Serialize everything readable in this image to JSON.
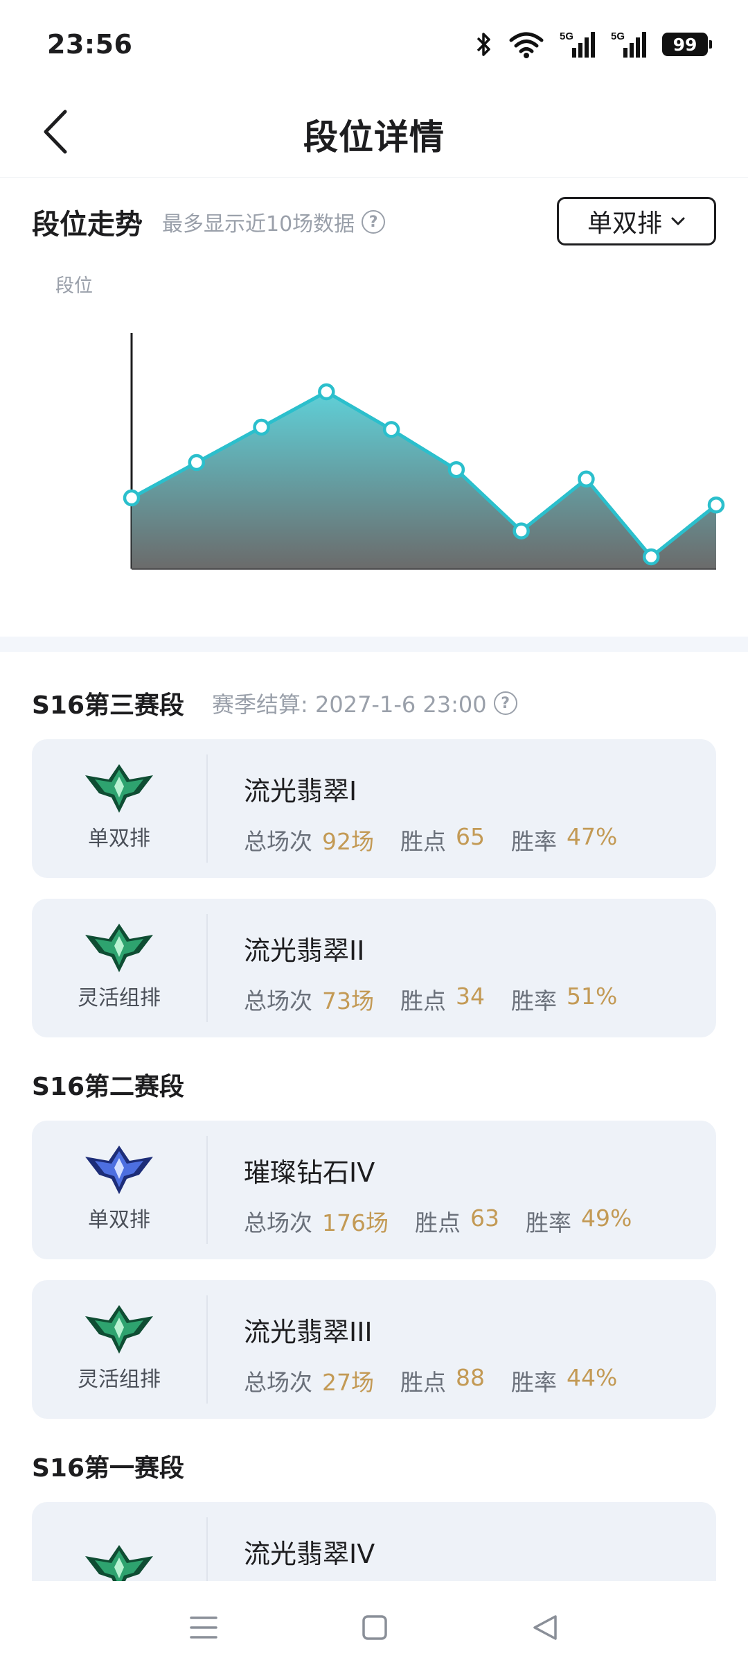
{
  "status": {
    "time": "23:56",
    "battery": "99",
    "signal1": "5G",
    "signal2": "5G"
  },
  "header": {
    "title": "段位详情"
  },
  "trend": {
    "title": "段位走势",
    "subtitle": "最多显示近10场数据",
    "queue_selected": "单双排",
    "axis_label": "段位"
  },
  "chart_data": {
    "type": "area",
    "ylabel": "段位",
    "points": [
      3.0,
      4.5,
      6.0,
      7.5,
      5.9,
      4.2,
      1.6,
      3.8,
      0.5,
      2.7
    ],
    "ylim": [
      0,
      10
    ],
    "grid": false,
    "color": "#2bbfcc"
  },
  "seasons": [
    {
      "title": "S16第三赛段",
      "settle": "赛季结算: 2027-1-6 23:00",
      "cards": [
        {
          "queue": "单双排",
          "rank": "流光翡翠I",
          "games_label": "总场次",
          "games": "92场",
          "lp_label": "胜点",
          "lp": "65",
          "wr_label": "胜率",
          "wr": "47%",
          "tier": "emerald"
        },
        {
          "queue": "灵活组排",
          "rank": "流光翡翠II",
          "games_label": "总场次",
          "games": "73场",
          "lp_label": "胜点",
          "lp": "34",
          "wr_label": "胜率",
          "wr": "51%",
          "tier": "emerald"
        }
      ]
    },
    {
      "title": "S16第二赛段",
      "cards": [
        {
          "queue": "单双排",
          "rank": "璀璨钻石IV",
          "games_label": "总场次",
          "games": "176场",
          "lp_label": "胜点",
          "lp": "63",
          "wr_label": "胜率",
          "wr": "49%",
          "tier": "diamond"
        },
        {
          "queue": "灵活组排",
          "rank": "流光翡翠III",
          "games_label": "总场次",
          "games": "27场",
          "lp_label": "胜点",
          "lp": "88",
          "wr_label": "胜率",
          "wr": "44%",
          "tier": "emerald"
        }
      ]
    },
    {
      "title": "S16第一赛段",
      "cards": [
        {
          "queue": "",
          "rank": "流光翡翠IV",
          "tier": "emerald"
        }
      ]
    }
  ],
  "colors": {
    "accent": "#2bbfcc",
    "stat_value": "#c39a55",
    "card_bg": "#eef2f8",
    "emerald": "#1f8a5a",
    "diamond": "#3a5bd0"
  }
}
